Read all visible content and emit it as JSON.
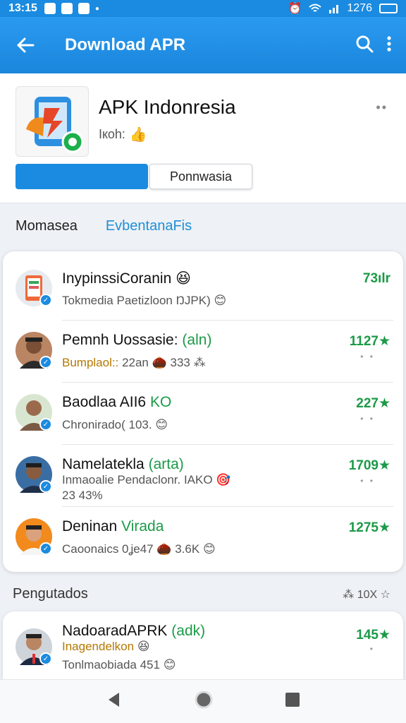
{
  "status_bar": {
    "time": "13:15",
    "battery_text": "1276"
  },
  "app_bar": {
    "title": "Download APR"
  },
  "app": {
    "name": "APK Indonresia",
    "subtitle": "Iкoh:",
    "secondary_button_label": "Ponnwasia"
  },
  "tabs": [
    {
      "label": "Momasea"
    },
    {
      "label": "EvbentanaFis"
    }
  ],
  "rows": [
    {
      "name": "InypinssiCoranin",
      "tag": "",
      "emoji": "😆",
      "sub": "Tokmedia Paetizloon ŊJPK)",
      "sub_emoji": "😊",
      "rating": "73ılr",
      "dots": ""
    },
    {
      "name": "Pemnh Uossasie:",
      "tag": "(aln)",
      "emoji": "",
      "sub": "Bumplaol::",
      "sub_extra": "22an",
      "sub_emoji": "🌰 333 ⁂",
      "rating": "1127★",
      "dots": "• •"
    },
    {
      "name": "Baodlaa AII6",
      "tag": "KO",
      "emoji": "",
      "sub": "Chronirado(",
      "sub_extra": "103.",
      "sub_emoji": "😊",
      "rating": "227★",
      "dots": "• •"
    },
    {
      "name": "Namelatekla",
      "tag": "(arta)",
      "emoji": "",
      "sub": "Inmaoalie Pendaclonr. IAKO",
      "sub_extra": "23 43%",
      "sub_emoji": "🎯",
      "rating": "1709★",
      "dots": "• •"
    },
    {
      "name": "Deninan",
      "tag": "Virada",
      "emoji": "",
      "sub": "Caoonaics 0ʝe47",
      "sub_extra": "",
      "sub_emoji": "🌰 3.6K 😊",
      "rating": "1275★",
      "dots": ""
    }
  ],
  "section": {
    "title": "Pengutados",
    "meta": "⁂ 10X ☆"
  },
  "row2": {
    "name": "NadoaradAPRK",
    "tag": "(adk)",
    "line2": "Inagendelkon",
    "line2_emoji": "😆",
    "sub": "Tonlmaobiada",
    "sub_extra": "451",
    "sub_emoji": "😊",
    "rating": "145★",
    "dots": "•"
  },
  "colors": {
    "accent": "#1a8be0",
    "green": "#1b9a47",
    "amber": "#b57800"
  }
}
